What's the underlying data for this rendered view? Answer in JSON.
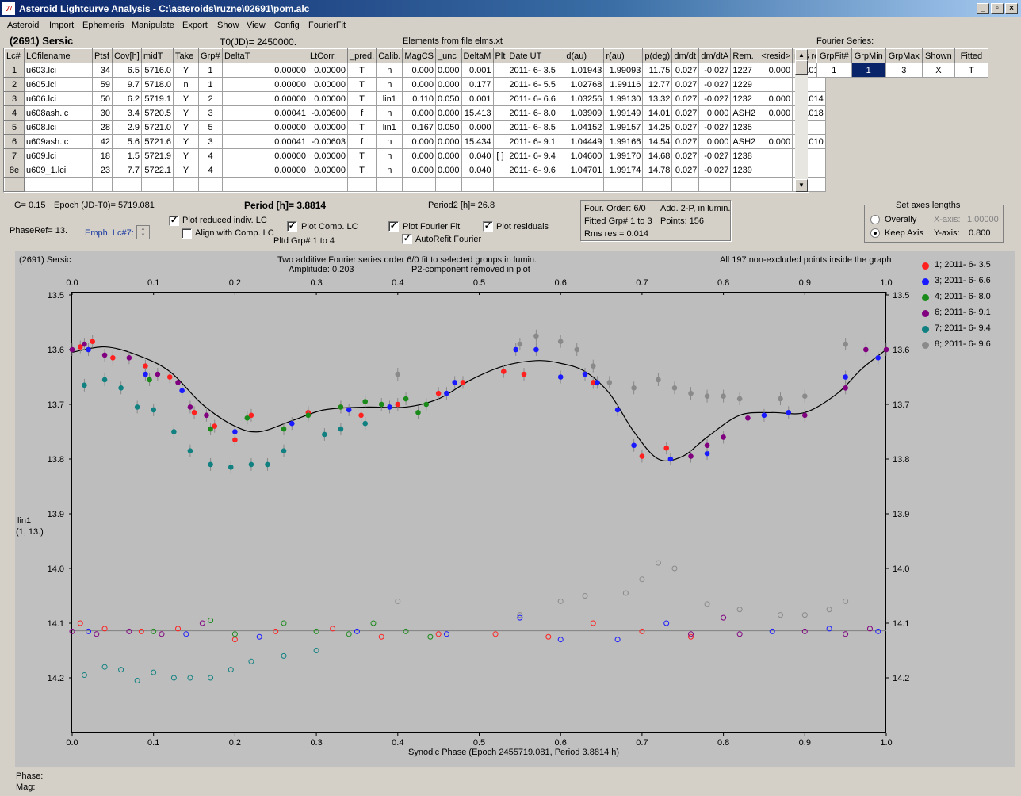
{
  "window": {
    "title": "Asteroid Lightcurve Analysis - C:\\asteroids\\ruzne\\02691\\pom.alc",
    "buttons": [
      "_",
      "▫",
      "×"
    ]
  },
  "menu": [
    "Asteroid",
    "Import",
    "Ephemeris",
    "Manipulate",
    "Export",
    "Show",
    "View",
    "Config",
    "FourierFit"
  ],
  "header": {
    "asteroid": "(2691) Sersic",
    "t0": "T0(JD)= 2450000.",
    "elements": "Elements from file elms.xt",
    "fourier_series": "Fourier Series:"
  },
  "lc_table": {
    "columns": [
      "Lc#",
      "LCfilename",
      "Ptsf",
      "Cov[h]",
      "midT",
      "Take",
      "Grp#",
      "DeltaT",
      "LtCorr.",
      "_pred.",
      "Calib.",
      "MagCS",
      "_unc",
      "DeltaM",
      "Plt",
      "Date UT",
      "d(au)",
      "r(au)",
      "p(deg)",
      "dm/dt",
      "dm/dtA",
      "Rem.",
      "<resid>",
      "rms res"
    ],
    "rows": [
      [
        "1",
        "u603.lci",
        "34",
        "6.5",
        "5716.0",
        "Y",
        "1",
        "0.00000",
        "0.00000",
        "T",
        "n",
        "0.000",
        "0.000",
        "0.001",
        "",
        "2011- 6- 3.5",
        "1.01943",
        "1.99093",
        "11.75",
        "0.027",
        "-0.027",
        "1227",
        "0.000",
        "0.012"
      ],
      [
        "2",
        "u605.lci",
        "59",
        "9.7",
        "5718.0",
        "n",
        "1",
        "0.00000",
        "0.00000",
        "T",
        "n",
        "0.000",
        "0.000",
        "0.177",
        "",
        "2011- 6- 5.5",
        "1.02768",
        "1.99116",
        "12.77",
        "0.027",
        "-0.027",
        "1229",
        "",
        ""
      ],
      [
        "3",
        "u606.lci",
        "50",
        "6.2",
        "5719.1",
        "Y",
        "2",
        "0.00000",
        "0.00000",
        "T",
        "lin1",
        "0.110",
        "0.050",
        "0.001",
        "",
        "2011- 6- 6.6",
        "1.03256",
        "1.99130",
        "13.32",
        "0.027",
        "-0.027",
        "1232",
        "0.000",
        "0.014"
      ],
      [
        "4",
        "u608ash.lc",
        "30",
        "3.4",
        "5720.5",
        "Y",
        "3",
        "0.00041",
        "-0.00600",
        "f",
        "n",
        "0.000",
        "0.000",
        "15.413",
        "",
        "2011- 6- 8.0",
        "1.03909",
        "1.99149",
        "14.01",
        "0.027",
        "0.000",
        "ASH2",
        "0.000",
        "0.018"
      ],
      [
        "5",
        "u608.lci",
        "28",
        "2.9",
        "5721.0",
        "Y",
        "5",
        "0.00000",
        "0.00000",
        "T",
        "lin1",
        "0.167",
        "0.050",
        "0.000",
        "",
        "2011- 6- 8.5",
        "1.04152",
        "1.99157",
        "14.25",
        "0.027",
        "-0.027",
        "1235",
        "",
        ""
      ],
      [
        "6",
        "u609ash.lc",
        "42",
        "5.6",
        "5721.6",
        "Y",
        "3",
        "0.00041",
        "-0.00603",
        "f",
        "n",
        "0.000",
        "0.000",
        "15.434",
        "",
        "2011- 6- 9.1",
        "1.04449",
        "1.99166",
        "14.54",
        "0.027",
        "0.000",
        "ASH2",
        "0.000",
        "0.010"
      ],
      [
        "7",
        "u609.lci",
        "18",
        "1.5",
        "5721.9",
        "Y",
        "4",
        "0.00000",
        "0.00000",
        "T",
        "n",
        "0.000",
        "0.000",
        "0.040",
        "[ ]",
        "2011- 6- 9.4",
        "1.04600",
        "1.99170",
        "14.68",
        "0.027",
        "-0.027",
        "1238",
        "",
        ""
      ],
      [
        "8e",
        "u609_1.lci",
        "23",
        "7.7",
        "5722.1",
        "Y",
        "4",
        "0.00000",
        "0.00000",
        "T",
        "n",
        "0.000",
        "0.000",
        "0.040",
        "",
        "2011- 6- 9.6",
        "1.04701",
        "1.99174",
        "14.78",
        "0.027",
        "-0.027",
        "1239",
        "",
        ""
      ]
    ]
  },
  "fourier_table": {
    "columns": [
      "GrpFit#",
      "GrpMin",
      "GrpMax",
      "Shown",
      "Fitted"
    ],
    "rows": [
      [
        "1",
        "1",
        "3",
        "X",
        "T"
      ]
    ]
  },
  "controls": {
    "g": "G= 0.15",
    "epoch": "Epoch (JD-T0)= 5719.081",
    "period": "Period [h]= 3.8814",
    "period2": "Period2 [h]= 26.8",
    "phaseref": "PhaseRef= 13.",
    "emph": "Emph. Lc#7:",
    "plot_reduced": "Plot reduced indiv. LC",
    "align": "Align with Comp. LC",
    "plot_comp": "Plot Comp. LC",
    "pltd_grp": "Pltd Grp#  1   to   4",
    "plot_fourier": "Plot Fourier Fit",
    "autorefit": "AutoRefit Fourier",
    "plot_residuals": "Plot residuals"
  },
  "info_box": {
    "line1a": "Four. Order:  6/0",
    "line1b": "Add. 2-P, in lumin.",
    "line2a": "Fitted Grp# 1 to 3",
    "line2b": "Points: 156",
    "line3": "Rms res      = 0.014"
  },
  "axes_box": {
    "title": "Set axes lengths",
    "overally": "Overally",
    "keep": "Keep Axis",
    "xaxis_label": "X-axis:",
    "xaxis_value": "1.00000",
    "yaxis_label": "Y-axis:",
    "yaxis_value": "0.800"
  },
  "plot": {
    "name": "(2691) Sersic",
    "subtitle1": "Two additive Fourier series order 6/0 fit to selected groups in lumin.",
    "subtitle2a": "Amplitude: 0.203",
    "subtitle2b": "P2-component removed in plot",
    "right_note": "All 197 non-excluded points inside the graph",
    "ylabel1": "lin1",
    "ylabel2": "(1, 13.)",
    "xlabel": "Synodic Phase (Epoch 2455719.081, Period 3.8814 h)",
    "legend": [
      {
        "label": "1; 2011- 6- 3.5",
        "color": "#ff2020"
      },
      {
        "label": "3; 2011- 6- 6.6",
        "color": "#1a1aff"
      },
      {
        "label": "4; 2011- 6- 8.0",
        "color": "#1a8a1a"
      },
      {
        "label": "6; 2011- 6- 9.1",
        "color": "#800080"
      },
      {
        "label": "7; 2011- 6- 9.4",
        "color": "#108080"
      },
      {
        "label": "8; 2011- 6- 9.6",
        "color": "#8a8a8a"
      }
    ]
  },
  "status": {
    "phase": "Phase:",
    "mag": "Mag:"
  },
  "chart_data": {
    "type": "scatter",
    "xlabel": "Synodic Phase (Epoch 2455719.081, Period 3.8814 h)",
    "ylabel": "lin1 (1, 13.)",
    "xlim": [
      0.0,
      1.0
    ],
    "ylim": [
      14.3,
      13.5
    ],
    "x_ticks": [
      "0.0",
      "0.1",
      "0.2",
      "0.3",
      "0.4",
      "0.5",
      "0.6",
      "0.7",
      "0.8",
      "0.9",
      "1.0"
    ],
    "y_ticks": [
      "13.5",
      "13.6",
      "13.7",
      "13.8",
      "13.9",
      "14.0",
      "14.1",
      "14.2"
    ],
    "residual_baseline": 14.114,
    "fit_curve": [
      [
        0.0,
        13.605
      ],
      [
        0.04,
        13.595
      ],
      [
        0.08,
        13.61
      ],
      [
        0.12,
        13.64
      ],
      [
        0.16,
        13.7
      ],
      [
        0.2,
        13.74
      ],
      [
        0.23,
        13.75
      ],
      [
        0.27,
        13.73
      ],
      [
        0.31,
        13.71
      ],
      [
        0.36,
        13.705
      ],
      [
        0.41,
        13.705
      ],
      [
        0.45,
        13.69
      ],
      [
        0.49,
        13.655
      ],
      [
        0.53,
        13.63
      ],
      [
        0.57,
        13.62
      ],
      [
        0.6,
        13.625
      ],
      [
        0.63,
        13.64
      ],
      [
        0.66,
        13.68
      ],
      [
        0.69,
        13.75
      ],
      [
        0.72,
        13.8
      ],
      [
        0.75,
        13.795
      ],
      [
        0.78,
        13.76
      ],
      [
        0.82,
        13.72
      ],
      [
        0.86,
        13.715
      ],
      [
        0.9,
        13.715
      ],
      [
        0.94,
        13.68
      ],
      [
        0.97,
        13.635
      ],
      [
        1.0,
        13.6
      ]
    ],
    "series": [
      {
        "name": "1; 2011- 6- 3.5",
        "points": [
          [
            0.01,
            13.595
          ],
          [
            0.025,
            13.585
          ],
          [
            0.05,
            13.615
          ],
          [
            0.09,
            13.63
          ],
          [
            0.12,
            13.65
          ],
          [
            0.15,
            13.715
          ],
          [
            0.175,
            13.74
          ],
          [
            0.2,
            13.765
          ],
          [
            0.22,
            13.72
          ],
          [
            0.29,
            13.715
          ],
          [
            0.33,
            13.705
          ],
          [
            0.355,
            13.72
          ],
          [
            0.4,
            13.7
          ],
          [
            0.45,
            13.68
          ],
          [
            0.48,
            13.66
          ],
          [
            0.53,
            13.64
          ],
          [
            0.555,
            13.645
          ],
          [
            0.64,
            13.66
          ],
          [
            0.7,
            13.795
          ],
          [
            0.73,
            13.78
          ]
        ],
        "residuals": [
          [
            0.01,
            14.1
          ],
          [
            0.04,
            14.11
          ],
          [
            0.085,
            14.115
          ],
          [
            0.13,
            14.11
          ],
          [
            0.2,
            14.13
          ],
          [
            0.25,
            14.115
          ],
          [
            0.32,
            14.11
          ],
          [
            0.38,
            14.125
          ],
          [
            0.45,
            14.12
          ],
          [
            0.52,
            14.12
          ],
          [
            0.585,
            14.125
          ],
          [
            0.64,
            14.1
          ],
          [
            0.7,
            14.115
          ],
          [
            0.76,
            14.125
          ]
        ]
      },
      {
        "name": "3; 2011- 6- 6.6",
        "points": [
          [
            0.02,
            13.6
          ],
          [
            0.09,
            13.645
          ],
          [
            0.135,
            13.675
          ],
          [
            0.2,
            13.75
          ],
          [
            0.27,
            13.735
          ],
          [
            0.34,
            13.71
          ],
          [
            0.39,
            13.705
          ],
          [
            0.46,
            13.68
          ],
          [
            0.47,
            13.66
          ],
          [
            0.545,
            13.6
          ],
          [
            0.57,
            13.6
          ],
          [
            0.6,
            13.65
          ],
          [
            0.63,
            13.645
          ],
          [
            0.645,
            13.66
          ],
          [
            0.67,
            13.71
          ],
          [
            0.69,
            13.775
          ],
          [
            0.735,
            13.8
          ],
          [
            0.78,
            13.79
          ],
          [
            0.85,
            13.72
          ],
          [
            0.88,
            13.715
          ],
          [
            0.95,
            13.65
          ],
          [
            0.99,
            13.615
          ]
        ],
        "residuals": [
          [
            0.02,
            14.115
          ],
          [
            0.14,
            14.12
          ],
          [
            0.23,
            14.125
          ],
          [
            0.35,
            14.115
          ],
          [
            0.46,
            14.12
          ],
          [
            0.55,
            14.09
          ],
          [
            0.6,
            14.13
          ],
          [
            0.67,
            14.13
          ],
          [
            0.73,
            14.1
          ],
          [
            0.86,
            14.115
          ],
          [
            0.93,
            14.11
          ],
          [
            0.99,
            14.115
          ]
        ]
      },
      {
        "name": "4; 2011- 6- 8.0",
        "points": [
          [
            0.095,
            13.655
          ],
          [
            0.17,
            13.745
          ],
          [
            0.215,
            13.725
          ],
          [
            0.26,
            13.745
          ],
          [
            0.29,
            13.72
          ],
          [
            0.33,
            13.705
          ],
          [
            0.36,
            13.695
          ],
          [
            0.38,
            13.7
          ],
          [
            0.41,
            13.69
          ],
          [
            0.425,
            13.715
          ],
          [
            0.435,
            13.7
          ]
        ],
        "residuals": [
          [
            0.1,
            14.115
          ],
          [
            0.17,
            14.095
          ],
          [
            0.2,
            14.12
          ],
          [
            0.26,
            14.1
          ],
          [
            0.3,
            14.115
          ],
          [
            0.34,
            14.12
          ],
          [
            0.37,
            14.1
          ],
          [
            0.41,
            14.115
          ],
          [
            0.44,
            14.125
          ]
        ]
      },
      {
        "name": "6; 2011- 6- 9.1",
        "points": [
          [
            0.0,
            13.6
          ],
          [
            0.015,
            13.59
          ],
          [
            0.04,
            13.61
          ],
          [
            0.07,
            13.615
          ],
          [
            0.105,
            13.645
          ],
          [
            0.13,
            13.66
          ],
          [
            0.145,
            13.705
          ],
          [
            0.165,
            13.72
          ],
          [
            0.76,
            13.795
          ],
          [
            0.78,
            13.775
          ],
          [
            0.8,
            13.76
          ],
          [
            0.83,
            13.725
          ],
          [
            0.9,
            13.72
          ],
          [
            0.95,
            13.67
          ],
          [
            0.975,
            13.6
          ],
          [
            1.0,
            13.6
          ]
        ],
        "residuals": [
          [
            0.0,
            14.115
          ],
          [
            0.03,
            14.12
          ],
          [
            0.07,
            14.115
          ],
          [
            0.11,
            14.12
          ],
          [
            0.16,
            14.1
          ],
          [
            0.76,
            14.12
          ],
          [
            0.8,
            14.09
          ],
          [
            0.82,
            14.12
          ],
          [
            0.9,
            14.115
          ],
          [
            0.95,
            14.12
          ],
          [
            0.98,
            14.11
          ]
        ]
      },
      {
        "name": "7; 2011- 6- 9.4",
        "points": [
          [
            0.015,
            13.665
          ],
          [
            0.04,
            13.655
          ],
          [
            0.06,
            13.67
          ],
          [
            0.08,
            13.705
          ],
          [
            0.1,
            13.71
          ],
          [
            0.125,
            13.75
          ],
          [
            0.145,
            13.785
          ],
          [
            0.17,
            13.81
          ],
          [
            0.195,
            13.815
          ],
          [
            0.22,
            13.81
          ],
          [
            0.24,
            13.81
          ],
          [
            0.26,
            13.785
          ],
          [
            0.31,
            13.755
          ],
          [
            0.33,
            13.745
          ],
          [
            0.36,
            13.735
          ]
        ],
        "residuals": [
          [
            0.015,
            14.195
          ],
          [
            0.04,
            14.18
          ],
          [
            0.06,
            14.185
          ],
          [
            0.08,
            14.205
          ],
          [
            0.1,
            14.19
          ],
          [
            0.125,
            14.2
          ],
          [
            0.145,
            14.2
          ],
          [
            0.17,
            14.2
          ],
          [
            0.195,
            14.185
          ],
          [
            0.22,
            14.17
          ],
          [
            0.26,
            14.16
          ],
          [
            0.3,
            14.15
          ]
        ]
      },
      {
        "name": "8; 2011- 6- 9.6",
        "points": [
          [
            0.4,
            13.645
          ],
          [
            0.55,
            13.59
          ],
          [
            0.57,
            13.575
          ],
          [
            0.6,
            13.585
          ],
          [
            0.62,
            13.6
          ],
          [
            0.64,
            13.63
          ],
          [
            0.66,
            13.66
          ],
          [
            0.69,
            13.67
          ],
          [
            0.72,
            13.655
          ],
          [
            0.74,
            13.67
          ],
          [
            0.76,
            13.68
          ],
          [
            0.78,
            13.685
          ],
          [
            0.8,
            13.685
          ],
          [
            0.82,
            13.69
          ],
          [
            0.87,
            13.69
          ],
          [
            0.9,
            13.685
          ],
          [
            0.95,
            13.59
          ]
        ],
        "residuals": [
          [
            0.4,
            14.06
          ],
          [
            0.55,
            14.085
          ],
          [
            0.6,
            14.06
          ],
          [
            0.63,
            14.05
          ],
          [
            0.68,
            14.045
          ],
          [
            0.7,
            14.02
          ],
          [
            0.72,
            13.99
          ],
          [
            0.74,
            14.0
          ],
          [
            0.78,
            14.065
          ],
          [
            0.82,
            14.075
          ],
          [
            0.87,
            14.085
          ],
          [
            0.9,
            14.085
          ],
          [
            0.93,
            14.075
          ],
          [
            0.95,
            14.06
          ]
        ]
      }
    ]
  }
}
